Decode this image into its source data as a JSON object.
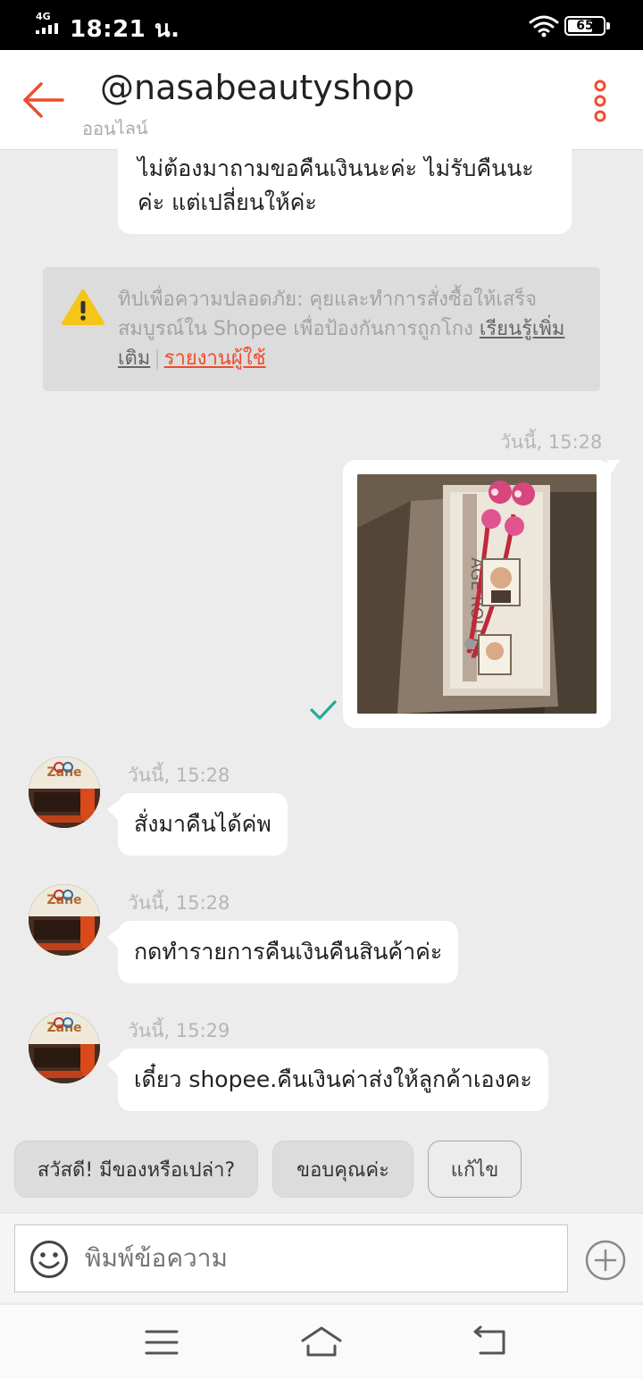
{
  "status_bar": {
    "network": "4G",
    "time": "18:21 น.",
    "battery": "65"
  },
  "header": {
    "shop_name": "@nasabeautyshop",
    "status": "ออนไลน์"
  },
  "messages": {
    "partial_text": "ไม่ต้องมาถามขอคืนเงินนะค่ะ ไม่รับคืนนะค่ะ  แต่เปลี่ยนให้ค่ะ",
    "image_time": "วันนี้, 15:28",
    "incoming": [
      {
        "time": "วันนี้, 15:28",
        "text": "สั่งมาคืนได้ค่พ"
      },
      {
        "time": "วันนี้, 15:28",
        "text": "กดทำรายการคืนเงินคืนสินค้าค่ะ"
      },
      {
        "time": "วันนี้, 15:29",
        "text": "เดี๋ยว shopee.คืนเงินค่าส่งให้ลูกค้าเองคะ"
      }
    ]
  },
  "tip": {
    "text": "ทิปเพื่อความปลอดภัย: คุยและทำการสั่งซื้อให้เสร็จสมบูรณ์ใน Shopee เพื่อป้องกันการถูกโกง ",
    "learn_more": "เรียนรู้เพิ่มเติม",
    "separator": "|",
    "report": "รายงานผู้ใช้"
  },
  "quick_replies": [
    "สวัสดี! มีของหรือเปล่า?",
    "ขอบคุณค่ะ",
    "แก้ไข"
  ],
  "input": {
    "placeholder": "พิมพ์ข้อความ"
  },
  "colors": {
    "accent": "#ee4d2d",
    "check": "#26aa99",
    "background": "#ececec"
  }
}
